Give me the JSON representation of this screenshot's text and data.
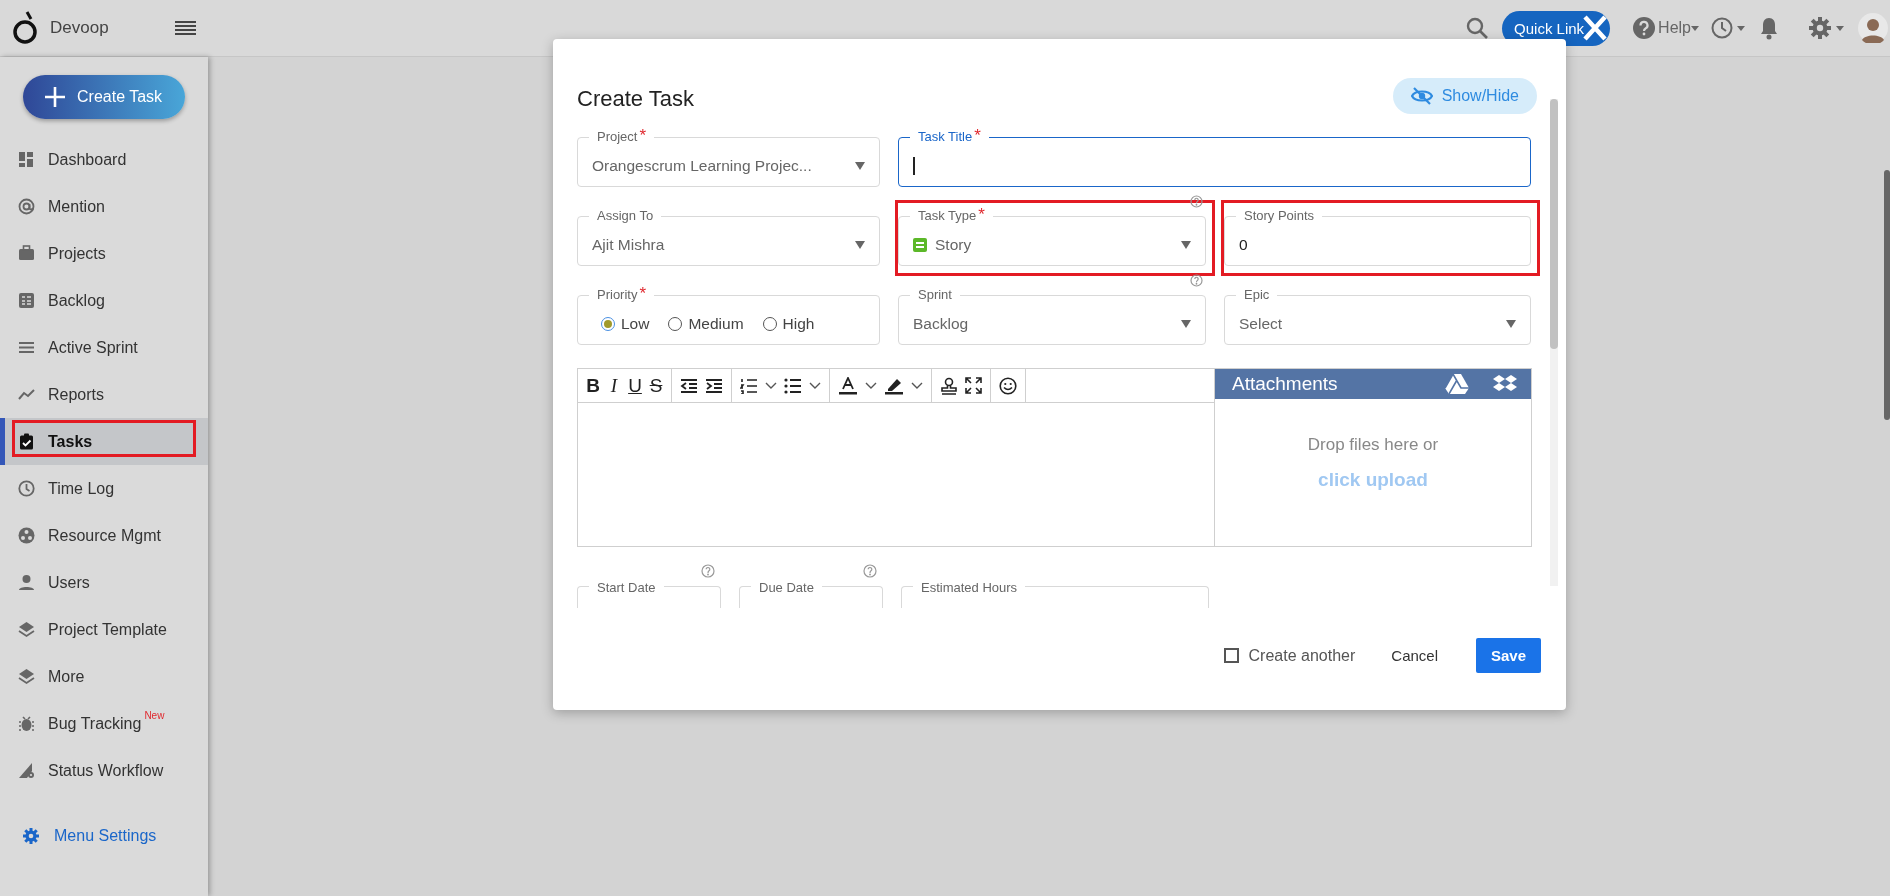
{
  "header": {
    "brand": "Devoop",
    "quick_link": "Quick Link",
    "help": "Help"
  },
  "sidebar": {
    "create_button": "Create Task",
    "items": [
      {
        "label": "Dashboard",
        "selected": false,
        "highlighted": false
      },
      {
        "label": "Mention",
        "selected": false,
        "highlighted": false
      },
      {
        "label": "Projects",
        "selected": false,
        "highlighted": false
      },
      {
        "label": "Backlog",
        "selected": false,
        "highlighted": false
      },
      {
        "label": "Active Sprint",
        "selected": false,
        "highlighted": false
      },
      {
        "label": "Reports",
        "selected": false,
        "highlighted": false
      },
      {
        "label": "Tasks",
        "selected": true,
        "highlighted": true
      },
      {
        "label": "Time Log",
        "selected": false,
        "highlighted": false
      },
      {
        "label": "Resource Mgmt",
        "selected": false,
        "highlighted": false
      },
      {
        "label": "Users",
        "selected": false,
        "highlighted": false
      },
      {
        "label": "Project Template",
        "selected": false,
        "highlighted": false
      },
      {
        "label": "More",
        "selected": false,
        "highlighted": false
      },
      {
        "label": "Bug Tracking",
        "badge": "New",
        "selected": false,
        "highlighted": false
      },
      {
        "label": "Status Workflow",
        "selected": false,
        "highlighted": false
      }
    ],
    "menu_settings": "Menu Settings"
  },
  "modal": {
    "title": "Create Task",
    "show_hide": "Show/Hide",
    "fields": [
      {
        "kind": "select",
        "label": "Project",
        "required_mark": "*",
        "value": "Orangescrum Learning Projec...",
        "help": false,
        "highlighted": false,
        "focused": false
      },
      {
        "kind": "text",
        "label": "Task Title",
        "required_mark": "*",
        "help": false,
        "highlighted": false,
        "focused": true
      },
      {
        "kind": "select",
        "label": "Assign To",
        "value": "Ajit Mishra",
        "help": false,
        "highlighted": false,
        "focused": false
      },
      {
        "kind": "type-select",
        "label": "Task Type",
        "required_mark": "*",
        "value": "Story",
        "help": true,
        "highlighted": true,
        "focused": false
      },
      {
        "kind": "text",
        "label": "Story Points",
        "value": "0",
        "help": false,
        "highlighted": true,
        "focused": false
      },
      {
        "kind": "radio",
        "label": "Priority",
        "required_mark": "*",
        "help": false,
        "highlighted": false,
        "focused": false,
        "options": [
          {
            "label": "Low",
            "selected": true
          },
          {
            "label": "Medium",
            "selected": false
          },
          {
            "label": "High",
            "selected": false
          }
        ]
      },
      {
        "kind": "select",
        "label": "Sprint",
        "value": "Backlog",
        "help": true,
        "highlighted": false,
        "focused": false
      },
      {
        "kind": "select",
        "label": "Epic",
        "value": "Select",
        "help": false,
        "highlighted": false,
        "focused": false
      }
    ],
    "editor": {
      "format_buttons": [
        "B",
        "I",
        "U",
        "S"
      ]
    },
    "attachments": {
      "title": "Attachments",
      "drop_text": "Drop files here or",
      "upload_link": "click upload"
    },
    "date_fields": [
      {
        "label": "Start Date",
        "help": true
      },
      {
        "label": "Due Date",
        "help": true
      },
      {
        "label": "Estimated Hours",
        "help": false
      }
    ],
    "footer": {
      "create_another": {
        "label": "Create another",
        "checked": false
      },
      "cancel": "Cancel",
      "save": "Save"
    }
  }
}
